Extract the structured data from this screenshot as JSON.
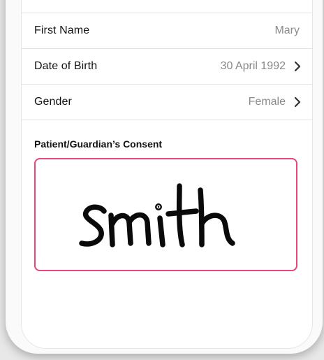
{
  "form": {
    "rows": [
      {
        "label": "First Name",
        "value": "Mary",
        "has_chevron": false
      },
      {
        "label": "Date of Birth",
        "value": "30 April 1992",
        "has_chevron": true
      },
      {
        "label": "Gender",
        "value": "Female",
        "has_chevron": true
      }
    ]
  },
  "consent": {
    "title": "Patient/Guardian’s Consent",
    "signature_text": "smith",
    "border_color": "#e8457a"
  },
  "icons": {
    "row_chevron": "chevron-right-icon"
  }
}
